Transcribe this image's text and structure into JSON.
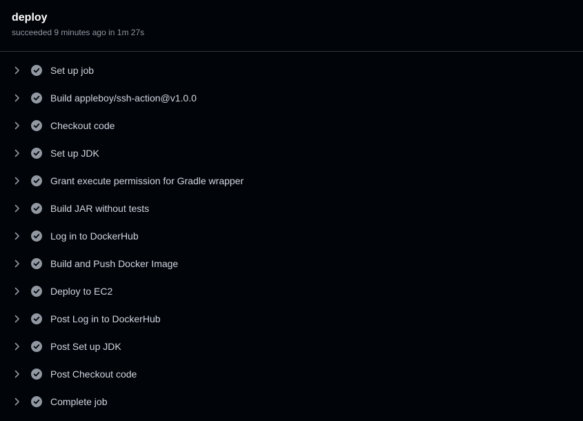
{
  "job": {
    "title": "deploy",
    "status": "succeeded 9 minutes ago in 1m 27s"
  },
  "colors": {
    "background": "#010409",
    "divider": "#30363d",
    "icon": "#9198a1",
    "text": "#d1d7e0"
  },
  "icons": {
    "expand": "chevron-right-icon",
    "status": "check-circle-icon"
  },
  "steps": [
    {
      "label": "Set up job",
      "status": "success"
    },
    {
      "label": "Build appleboy/ssh-action@v1.0.0",
      "status": "success"
    },
    {
      "label": "Checkout code",
      "status": "success"
    },
    {
      "label": "Set up JDK",
      "status": "success"
    },
    {
      "label": "Grant execute permission for Gradle wrapper",
      "status": "success"
    },
    {
      "label": "Build JAR without tests",
      "status": "success"
    },
    {
      "label": "Log in to DockerHub",
      "status": "success"
    },
    {
      "label": "Build and Push Docker Image",
      "status": "success"
    },
    {
      "label": "Deploy to EC2",
      "status": "success"
    },
    {
      "label": "Post Log in to DockerHub",
      "status": "success"
    },
    {
      "label": "Post Set up JDK",
      "status": "success"
    },
    {
      "label": "Post Checkout code",
      "status": "success"
    },
    {
      "label": "Complete job",
      "status": "success"
    }
  ]
}
